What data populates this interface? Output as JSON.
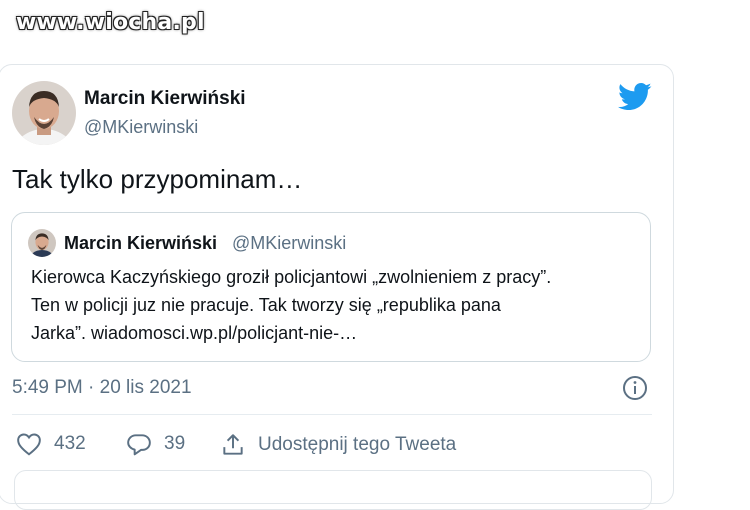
{
  "watermark": "www.wiocha.pl",
  "tweet": {
    "author_name": "Marcin Kierwiński",
    "author_handle": "@MKierwinski",
    "text": "Tak tylko przypominam…",
    "timestamp": "5:49 PM · 20 lis 2021",
    "likes": "432",
    "replies": "39",
    "share_label": "Udostępnij tego Tweeta",
    "brand_color": "#1d9bf0"
  },
  "quoted": {
    "author_name": "Marcin Kierwiński",
    "author_handle": "@MKierwinski",
    "lines": [
      "Kierowca Kaczyńskiego groził policjantowi „zwolnieniem z pracy”.",
      "Ten w policji juz nie pracuje. Tak tworzy się „republika pana",
      "Jarka”. wiadomosci.wp.pl/policjant-nie-…"
    ]
  },
  "icons": [
    "twitter-bird-icon",
    "info-icon",
    "heart-icon",
    "reply-icon",
    "share-icon"
  ]
}
